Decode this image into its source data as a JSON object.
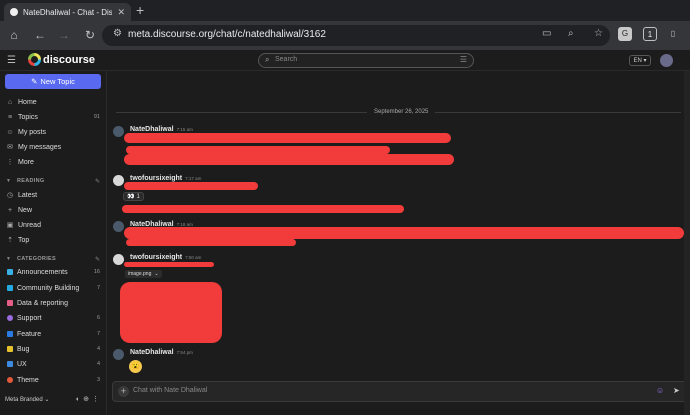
{
  "browser": {
    "tab_title": "NateDhaliwal - Chat - Disco",
    "url": "meta.discourse.org/chat/c/natedhaliwal/3162",
    "ext_badge": "1"
  },
  "header": {
    "logo_text": "discourse",
    "search_placeholder": "Search",
    "language": "EN"
  },
  "sidebar": {
    "new_topic": "New Topic",
    "top_items": [
      {
        "label": "Home",
        "icon": "home-icon",
        "glyph": "⌂",
        "count": ""
      },
      {
        "label": "Topics",
        "icon": "topics-icon",
        "glyph": "≡",
        "count": "91"
      },
      {
        "label": "My posts",
        "icon": "user-icon",
        "glyph": "☺",
        "count": ""
      },
      {
        "label": "My messages",
        "icon": "envelope-icon",
        "glyph": "✉",
        "count": ""
      },
      {
        "label": "More",
        "icon": "more-icon",
        "glyph": "⋮",
        "count": ""
      }
    ],
    "reading_label": "READING",
    "reading_items": [
      {
        "label": "Latest",
        "icon": "clock-icon",
        "glyph": "◷"
      },
      {
        "label": "New",
        "icon": "plus-icon",
        "glyph": "+"
      },
      {
        "label": "Unread",
        "icon": "unread-icon",
        "glyph": "▣"
      },
      {
        "label": "Top",
        "icon": "top-icon",
        "glyph": "⇡"
      }
    ],
    "categories_label": "CATEGORIES",
    "categories": [
      {
        "label": "Announcements",
        "count": "16",
        "color": "#3ab0e2"
      },
      {
        "label": "Community Building",
        "count": "7",
        "color": "#25aae1"
      },
      {
        "label": "Data & reporting",
        "count": "",
        "color": "#e45f86"
      },
      {
        "label": "Support",
        "count": "6",
        "color": "#9b6be0"
      },
      {
        "label": "Feature",
        "count": "7",
        "color": "#2a7ae2"
      },
      {
        "label": "Bug",
        "count": "4",
        "color": "#e6c12e"
      },
      {
        "label": "UX",
        "count": "4",
        "color": "#3c8be0"
      },
      {
        "label": "Theme",
        "count": "3",
        "color": "#e35a3a"
      }
    ],
    "footer_label": "Meta Branded"
  },
  "chat": {
    "date_separator": "September 26, 2025",
    "messages": [
      {
        "user": "NateDhaliwal",
        "time": "7:15 am",
        "avatar_color": "#4a5a6a"
      },
      {
        "user": "twofoursixeight",
        "time": "7:17 am",
        "avatar_color": "#d8d8d8",
        "reaction_emoji": "👀",
        "reaction_count": "1"
      },
      {
        "user": "NateDhaliwal",
        "time": "7:18 am",
        "avatar_color": "#4a5a6a"
      },
      {
        "user": "twofoursixeight",
        "time": "7:50 am",
        "avatar_color": "#d8d8d8",
        "attachment_label": "image.png"
      },
      {
        "user": "NateDhaliwal",
        "time": "7:54 pm",
        "avatar_color": "#4a5a6a",
        "emoji": "😮"
      }
    ],
    "composer_placeholder": "Chat with Nate Dhaliwal"
  }
}
